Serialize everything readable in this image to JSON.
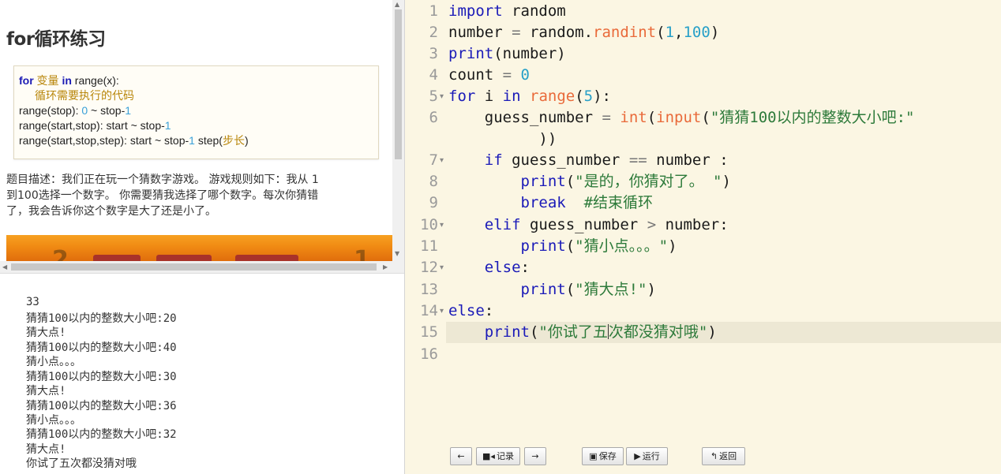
{
  "lesson": {
    "title": "for循环练习",
    "syntax": {
      "for_kw": "for",
      "var_text": " 变量 ",
      "in_kw": "in",
      "range_call": " range(x):",
      "body_comment": "循环需要执行的代码",
      "range1_prefix": "range(stop): ",
      "range1_zero": "0",
      "range1_mid": " ~ stop-",
      "range1_one": "1",
      "range2_prefix": "range(start,stop): start ~ stop-",
      "range2_one": "1",
      "range3_prefix": "range(start,stop,step): start ~ stop-",
      "range3_one": "1",
      "range3_step": " step(",
      "range3_step_cn": "步长",
      "range3_close": ")"
    },
    "description_lines": [
      "题目描述：我们正在玩一个猜数字游戏。 游戏规则如下：我从 1",
      "到100选择一个数字。 你需要猜我选择了哪个数字。每次你猜错",
      "了，我会告诉你这个数字是大了还是小了。"
    ],
    "banner_glyphs": [
      "2",
      "1"
    ]
  },
  "console": {
    "lines": [
      "33",
      "猜猜100以内的整数大小吧:20",
      "猜大点!",
      "猜猜100以内的整数大小吧:40",
      "猜小点。。。",
      "猜猜100以内的整数大小吧:30",
      "猜大点!",
      "猜猜100以内的整数大小吧:36",
      "猜小点。。。",
      "猜猜100以内的整数大小吧:32",
      "猜大点!",
      "你试了五次都没猜对哦"
    ]
  },
  "editor": {
    "line_numbers": [
      "1",
      "2",
      "3",
      "4",
      "5",
      "6",
      "",
      "7",
      "8",
      "9",
      "10",
      "11",
      "12",
      "13",
      "14",
      "15",
      "16"
    ],
    "code": {
      "l1_kw": "import",
      "l1_rest": " random",
      "l2_a": "number ",
      "l2_op": "=",
      "l2_b": " random.",
      "l2_fn": "randint",
      "l2_c": "(",
      "l2_n1": "1",
      "l2_d": ",",
      "l2_n2": "100",
      "l2_e": ")",
      "l3_fn": "print",
      "l3_rest": "(number)",
      "l4_a": "count ",
      "l4_op": "=",
      "l4_sp": " ",
      "l4_n": "0",
      "l5_for": "for",
      "l5_a": " i ",
      "l5_in": "in",
      "l5_sp": " ",
      "l5_fn": "range",
      "l5_b": "(",
      "l5_n": "5",
      "l5_c": "):",
      "l6_a": "    guess_number ",
      "l6_op": "=",
      "l6_sp": " ",
      "l6_int": "int",
      "l6_b": "(",
      "l6_input": "input",
      "l6_c": "(",
      "l6_str": "\"猜猜100以内的整数大小吧:\"",
      "l6w": "          ))",
      "l7_a": "    ",
      "l7_if": "if",
      "l7_b": " guess_number ",
      "l7_op": "==",
      "l7_c": " number :",
      "l8_a": "        ",
      "l8_fn": "print",
      "l8_b": "(",
      "l8_str": "\"是的，你猜对了。 \"",
      "l8_c": ")",
      "l9_a": "        ",
      "l9_kw": "break",
      "l9_sp": "  ",
      "l9_cm": "#结束循环",
      "l10_a": "    ",
      "l10_kw": "elif",
      "l10_b": " guess_number ",
      "l10_op": ">",
      "l10_c": " number:",
      "l11_a": "        ",
      "l11_fn": "print",
      "l11_b": "(",
      "l11_str": "\"猜小点。。。\"",
      "l11_c": ")",
      "l12_a": "    ",
      "l12_kw": "else",
      "l12_b": ":",
      "l13_a": "        ",
      "l13_fn": "print",
      "l13_b": "(",
      "l13_str": "\"猜大点!\"",
      "l13_c": ")",
      "l14_kw": "else",
      "l14_b": ":",
      "l15_a": "    ",
      "l15_fn": "print",
      "l15_b": "(",
      "l15_str1": "\"你试了五",
      "l15_str2": "次都没猜对哦\"",
      "l15_c": ")"
    }
  },
  "toolbar": {
    "back_arrow": "←",
    "record_label": "记录",
    "forward_arrow": "→",
    "save_label": "保存",
    "run_label": "运行",
    "return_label": "返回"
  },
  "colors": {
    "editor_bg": "#fbf6e3",
    "keyword": "#1a1ab8",
    "builtin": "#e96a3a",
    "number": "#27a0c8",
    "string": "#2d7a3a",
    "banner_orange": "#f08a13"
  }
}
